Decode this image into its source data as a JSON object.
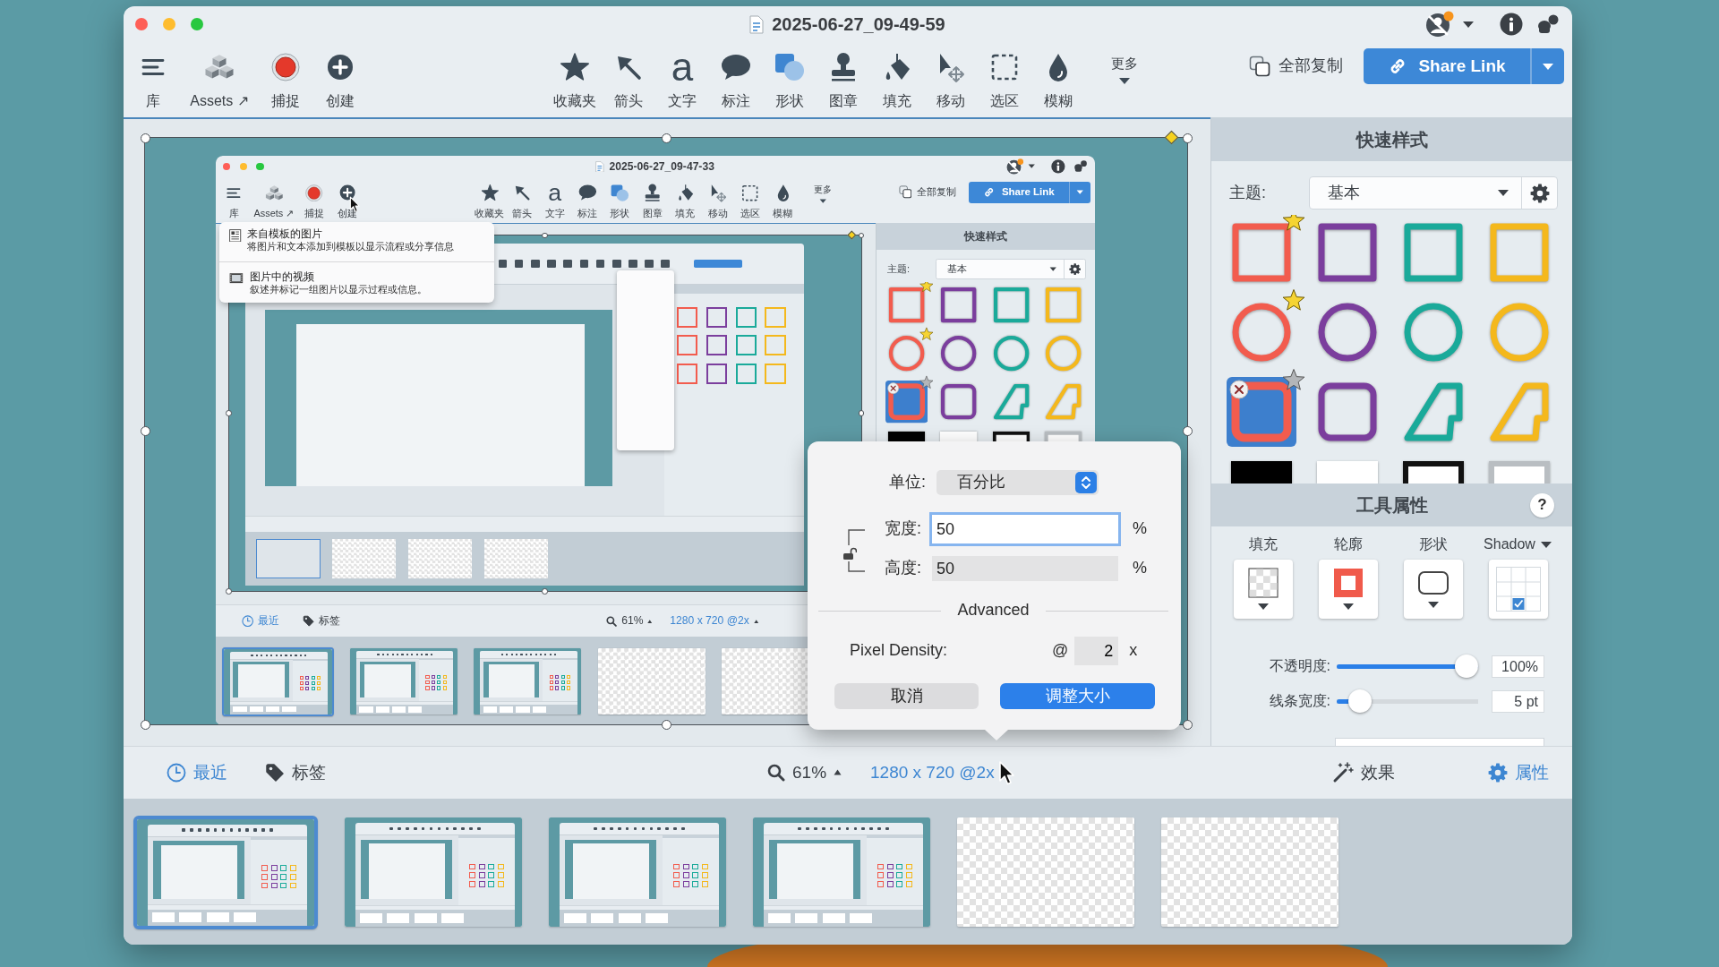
{
  "window": {
    "title": "2025-06-27_09-49-59",
    "toolbar": {
      "left_tools": [
        {
          "kind": "library",
          "label": "库",
          "hovered": false
        },
        {
          "kind": "assets",
          "label": "Assets ↗",
          "hovered": false
        },
        {
          "kind": "capture",
          "label": "捕捉",
          "hovered": false
        },
        {
          "kind": "create",
          "label": "创建",
          "hovered": false
        }
      ],
      "tools": [
        {
          "kind": "favorites",
          "label": "收藏夹"
        },
        {
          "kind": "arrow",
          "label": "箭头"
        },
        {
          "kind": "text",
          "label": "文字",
          "glyph": "a"
        },
        {
          "kind": "callout",
          "label": "标注"
        },
        {
          "kind": "shape",
          "label": "形状"
        },
        {
          "kind": "stamp",
          "label": "图章"
        },
        {
          "kind": "fill",
          "label": "填充"
        },
        {
          "kind": "move",
          "label": "移动"
        },
        {
          "kind": "selection",
          "label": "选区"
        },
        {
          "kind": "blur",
          "label": "模糊"
        }
      ],
      "more": "更多",
      "copy_all": "全部复制",
      "share": "Share Link"
    },
    "canvas": {
      "image": {
        "selected": true,
        "window": {
          "title": "2025-06-27_09-47-33",
          "toolbar": {
            "left_tools": [
              {
                "kind": "library",
                "label": "库",
                "hovered": false
              },
              {
                "kind": "assets",
                "label": "Assets ↗",
                "hovered": false
              },
              {
                "kind": "capture",
                "label": "捕捉",
                "hovered": false
              },
              {
                "kind": "create",
                "label": "创建",
                "hovered": true
              }
            ],
            "tools": [
              {
                "kind": "favorites",
                "label": "收藏夹"
              },
              {
                "kind": "arrow",
                "label": "箭头"
              },
              {
                "kind": "text",
                "label": "文字",
                "glyph": "a"
              },
              {
                "kind": "callout",
                "label": "标注"
              },
              {
                "kind": "shape",
                "label": "形状"
              },
              {
                "kind": "stamp",
                "label": "图章"
              },
              {
                "kind": "fill",
                "label": "填充"
              },
              {
                "kind": "move",
                "label": "移动"
              },
              {
                "kind": "selection",
                "label": "选区"
              },
              {
                "kind": "blur",
                "label": "模糊"
              }
            ],
            "more": "更多",
            "copy_all": "全部复制",
            "share": "Share Link"
          },
          "create_menu": {
            "items": [
              {
                "kind": "template",
                "title": "来自模板的图片",
                "description": "将图片和文本添加到模板以显示流程或分享信息"
              },
              {
                "kind": "video",
                "title": "图片中的视频",
                "description": "叙述并标记一组图片以显示过程或信息。"
              }
            ]
          },
          "canvas": {
            "image": {
              "selected": true
            }
          },
          "quick_styles": {
            "title": "快速样式",
            "theme_label": "主题:",
            "theme_value": "基本",
            "swatches": [
              {
                "kind": "square",
                "color": "#f25c4e",
                "favorite": true,
                "selected": false
              },
              {
                "kind": "square",
                "color": "#7b3e9d",
                "favorite": false,
                "selected": false
              },
              {
                "kind": "square",
                "color": "#1aaa9a",
                "favorite": false,
                "selected": false
              },
              {
                "kind": "square",
                "color": "#f4b81c",
                "favorite": false,
                "selected": false
              },
              {
                "kind": "circle",
                "color": "#f25c4e",
                "favorite": true,
                "selected": false
              },
              {
                "kind": "circle",
                "color": "#7b3e9d",
                "favorite": false,
                "selected": false
              },
              {
                "kind": "circle",
                "color": "#1aaa9a",
                "favorite": false,
                "selected": false
              },
              {
                "kind": "circle",
                "color": "#f4b81c",
                "favorite": false,
                "selected": false
              },
              {
                "kind": "rounded-square",
                "color": "#f25c4e",
                "favorite": false,
                "selected": true
              },
              {
                "kind": "rounded-square",
                "color": "#7b3e9d",
                "favorite": false,
                "selected": false
              },
              {
                "kind": "step",
                "color": "#1aaa9a",
                "favorite": false,
                "selected": false
              },
              {
                "kind": "step",
                "color": "#f4b81c",
                "favorite": false,
                "selected": false
              },
              {
                "kind": "filled-rect",
                "color": "#000000",
                "favorite": false,
                "selected": false
              },
              {
                "kind": "filled-rect",
                "color": "#ffffff",
                "favorite": false,
                "selected": false
              },
              {
                "kind": "rect",
                "color": "#111111",
                "favorite": false,
                "selected": false
              },
              {
                "kind": "rect",
                "color": "#b9bec2",
                "favorite": false,
                "selected": false
              }
            ]
          },
          "bottom_bar": {
            "recent": "最近",
            "tags": "标签",
            "zoom": "61%",
            "size": {
              "text": "1280 x 720 @2x",
              "hovered": false
            }
          },
          "thumbnails": [
            {
              "kind": "screenshot",
              "selected": true
            },
            {
              "kind": "screenshot",
              "selected": false
            },
            {
              "kind": "screenshot",
              "selected": false
            },
            {
              "kind": "transparent",
              "selected": false
            },
            {
              "kind": "transparent",
              "selected": false
            }
          ]
        }
      }
    },
    "quick_styles": {
      "title": "快速样式",
      "theme_label": "主题:",
      "theme_value": "基本",
      "swatches": [
        {
          "kind": "square",
          "color": "#f25c4e",
          "favorite": true,
          "selected": false
        },
        {
          "kind": "square",
          "color": "#7b3e9d",
          "favorite": false,
          "selected": false
        },
        {
          "kind": "square",
          "color": "#1aaa9a",
          "favorite": false,
          "selected": false
        },
        {
          "kind": "square",
          "color": "#f4b81c",
          "favorite": false,
          "selected": false
        },
        {
          "kind": "circle",
          "color": "#f25c4e",
          "favorite": true,
          "selected": false
        },
        {
          "kind": "circle",
          "color": "#7b3e9d",
          "favorite": false,
          "selected": false
        },
        {
          "kind": "circle",
          "color": "#1aaa9a",
          "favorite": false,
          "selected": false
        },
        {
          "kind": "circle",
          "color": "#f4b81c",
          "favorite": false,
          "selected": false
        },
        {
          "kind": "rounded-square",
          "color": "#f25c4e",
          "favorite": false,
          "selected": true
        },
        {
          "kind": "rounded-square",
          "color": "#7b3e9d",
          "favorite": false,
          "selected": false
        },
        {
          "kind": "step",
          "color": "#1aaa9a",
          "favorite": false,
          "selected": false
        },
        {
          "kind": "step",
          "color": "#f4b81c",
          "favorite": false,
          "selected": false
        },
        {
          "kind": "filled-rect",
          "color": "#000000",
          "favorite": false,
          "selected": false
        },
        {
          "kind": "filled-rect",
          "color": "#ffffff",
          "favorite": false,
          "selected": false
        },
        {
          "kind": "rect",
          "color": "#111111",
          "favorite": false,
          "selected": false
        },
        {
          "kind": "rect",
          "color": "#b9bec2",
          "favorite": false,
          "selected": false
        }
      ]
    },
    "tool_properties": {
      "title": "工具属性",
      "help": "?",
      "controls": [
        {
          "kind": "fill",
          "label": "填充"
        },
        {
          "kind": "outline",
          "label": "轮廓"
        },
        {
          "kind": "shape",
          "label": "形状"
        },
        {
          "kind": "shadow",
          "label": "Shadow"
        }
      ],
      "sliders": [
        {
          "label": "不透明度:",
          "level": 1,
          "reading": "100%"
        },
        {
          "label": "线条宽度:",
          "level": 0.1,
          "reading": "5 pt"
        }
      ]
    },
    "bottom_bar": {
      "recent": "最近",
      "tags": "标签",
      "zoom": "61%",
      "size": {
        "text": "1280 x 720 @2x",
        "hovered": true
      },
      "effects": "效果",
      "properties": "属性"
    },
    "thumbnails": [
      {
        "kind": "screenshot",
        "selected": true
      },
      {
        "kind": "screenshot",
        "selected": false
      },
      {
        "kind": "screenshot",
        "selected": false
      },
      {
        "kind": "screenshot",
        "selected": false
      },
      {
        "kind": "transparent",
        "selected": false
      },
      {
        "kind": "transparent",
        "selected": false
      }
    ],
    "resize_popover": {
      "unit_label": "单位:",
      "unit_value": "百分比",
      "fields": [
        {
          "label": "宽度:",
          "value": "50",
          "unit": "%",
          "focused": true
        },
        {
          "label": "高度:",
          "value": "50",
          "unit": "%",
          "focused": false
        }
      ],
      "locked": false,
      "section": "Advanced",
      "density_label": "Pixel Density:",
      "density_prefix": "@",
      "density_value": "2",
      "density_suffix": "x",
      "cancel": "取消",
      "confirm": "调整大小"
    }
  }
}
